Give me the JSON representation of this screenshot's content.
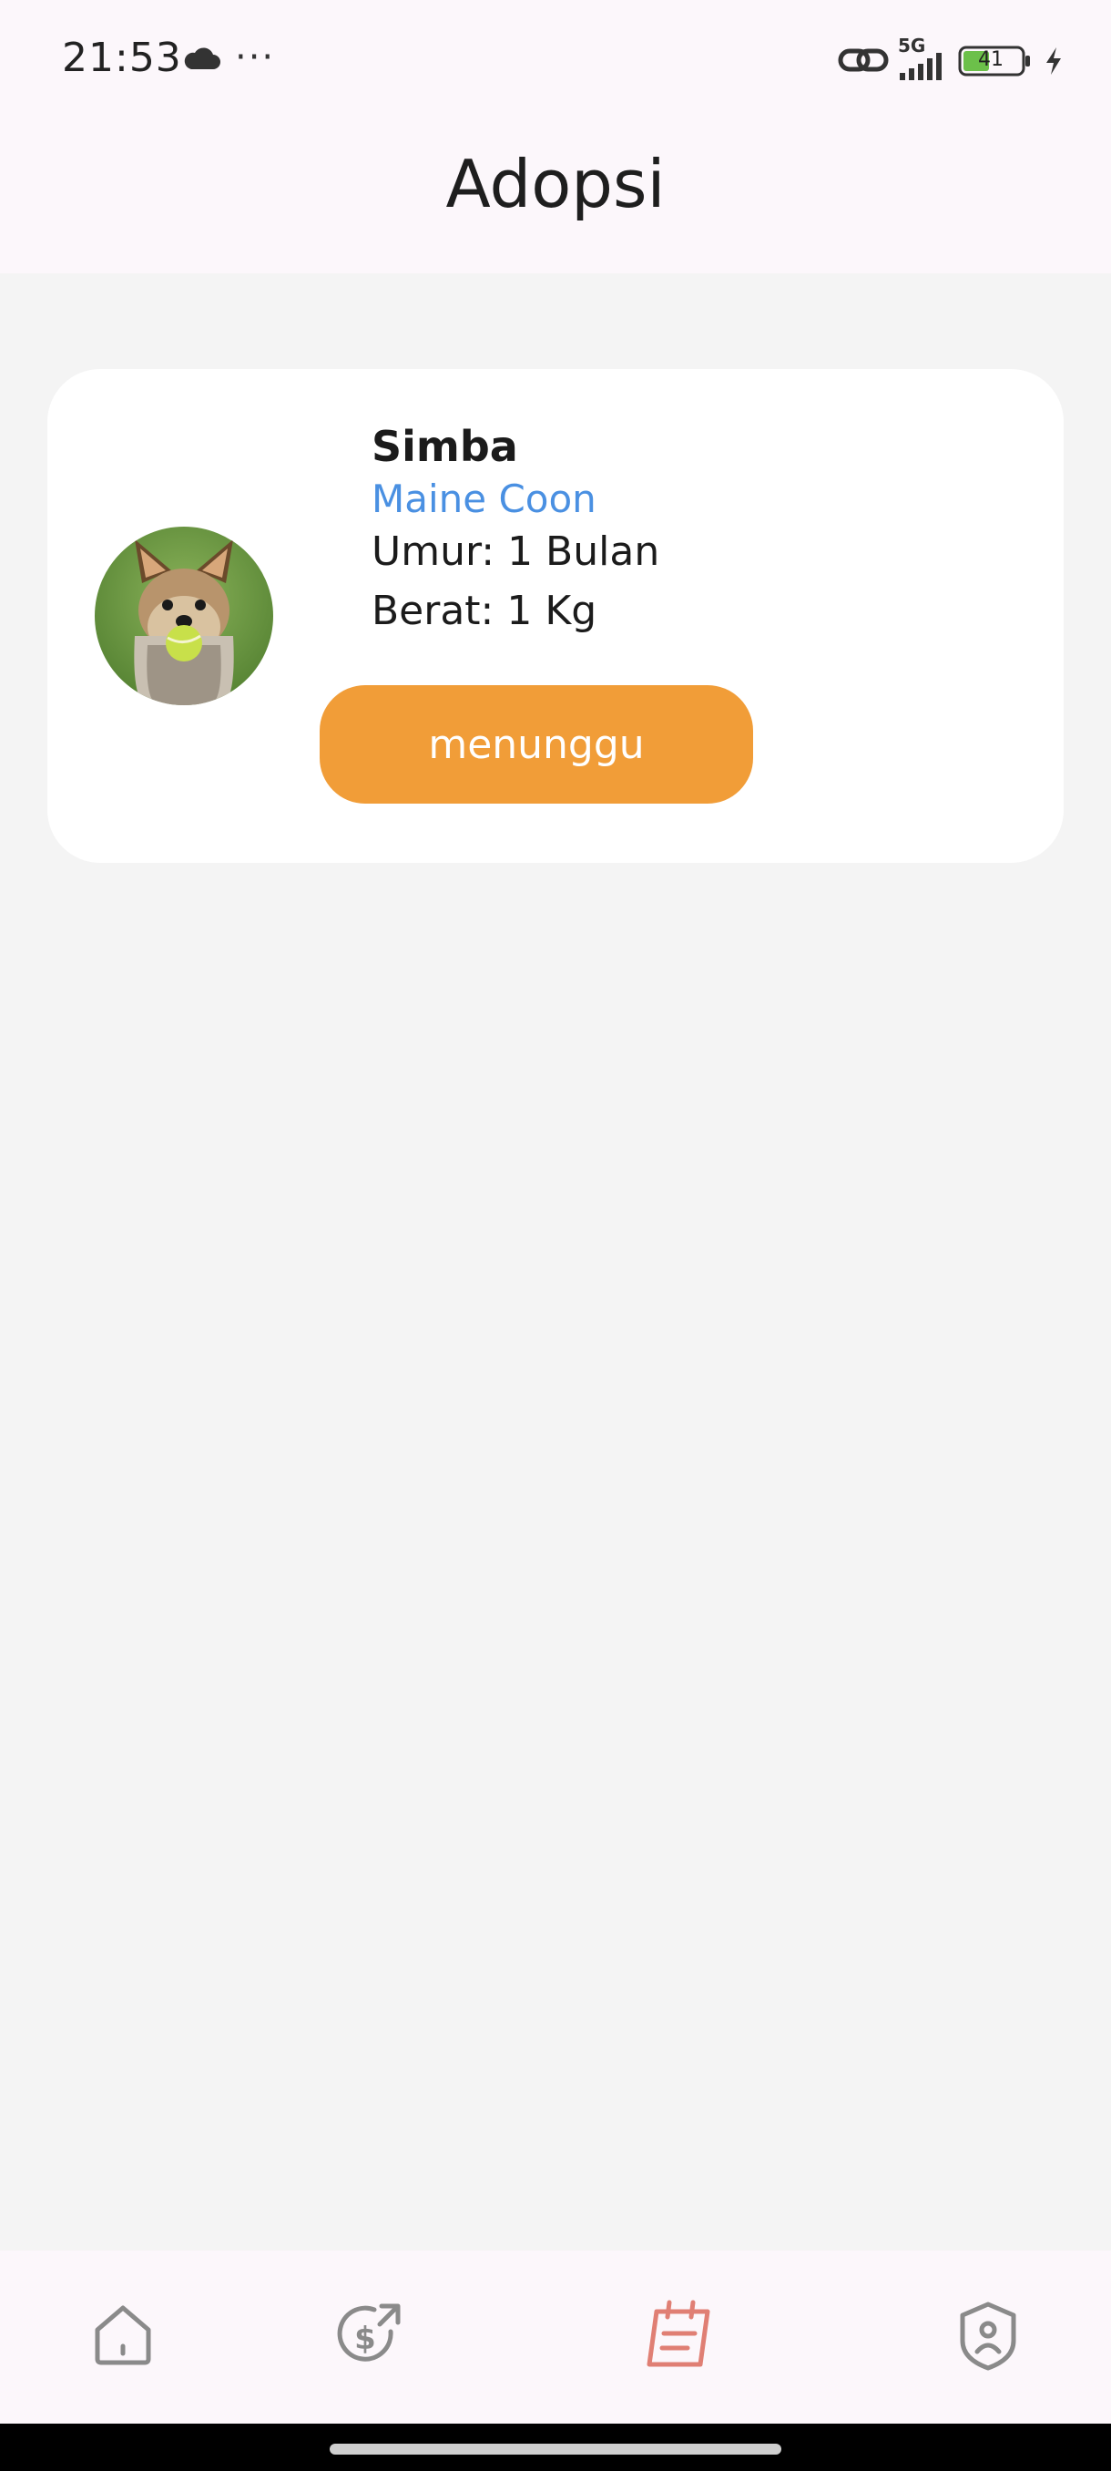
{
  "status_bar": {
    "time": "21:53",
    "more": "···",
    "network": "5G",
    "battery": "41",
    "icons": [
      "cloud-icon",
      "link-icon",
      "signal-icon",
      "battery-icon",
      "charging-icon"
    ]
  },
  "app_bar": {
    "title": "Adopsi"
  },
  "adoption_card": {
    "name": "Simba",
    "breed": "Maine Coon",
    "age": "Umur: 1 Bulan",
    "weight": "Berat: 1 Kg",
    "status_label": "menunggu",
    "photo": "dog-photo"
  },
  "bottom_nav": {
    "items": [
      {
        "icon": "home-icon",
        "active": false
      },
      {
        "icon": "donation-icon",
        "active": false
      },
      {
        "icon": "adoption-calendar-icon",
        "active": true
      },
      {
        "icon": "profile-icon",
        "active": false
      }
    ]
  },
  "colors": {
    "accent": "#f19d38",
    "breed_text": "#4a90e2",
    "active_nav": "#e07f74",
    "inactive_nav": "#8a8a8a",
    "bar_background": "#fcf7fb",
    "page_background": "#f4f4f4"
  }
}
